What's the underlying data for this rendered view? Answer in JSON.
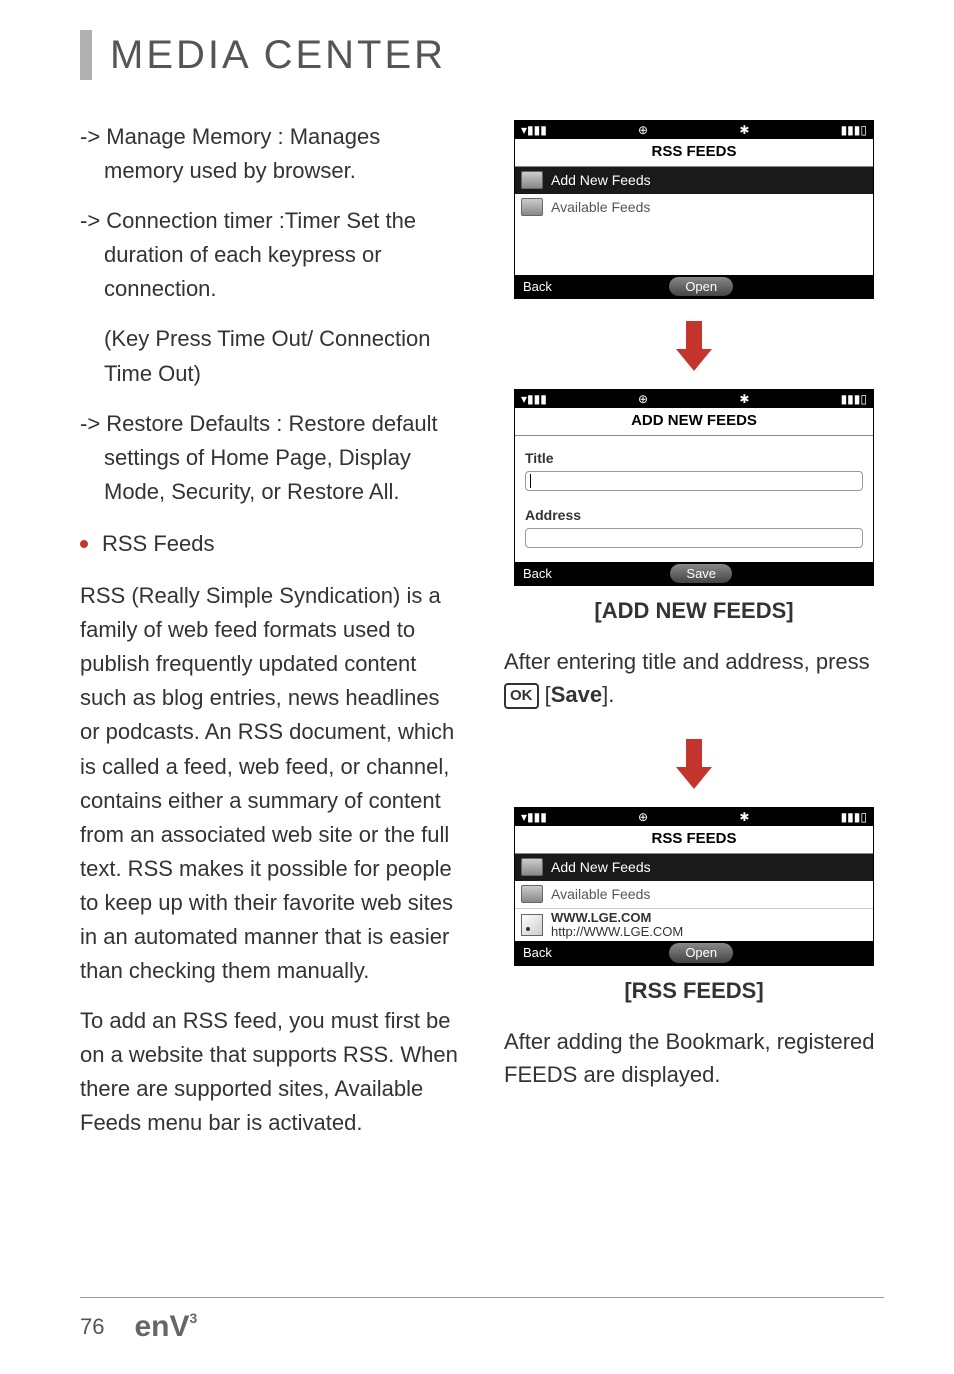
{
  "header": {
    "title": "MEDIA CENTER"
  },
  "left": {
    "item1": "-> Manage Memory : Manages memory used by browser.",
    "item2": "-> Connection timer :Timer Set the duration of each keypress or connection.",
    "item2_sub": "(Key Press Time Out/ Connection Time Out)",
    "item3": "-> Restore Defaults : Restore default settings of Home Page, Display Mode, Security, or Restore All.",
    "bullet": "RSS Feeds",
    "para1": "RSS (Really Simple Syndication) is a family of web feed formats used to publish frequently updated content such as blog entries, news headlines or podcasts. An RSS document, which is called a feed, web feed, or channel, contains either a summary of content from an associated web site or the full text. RSS makes it possible for people to keep up with their favorite web sites in an automated manner that is easier than checking them manually.",
    "para2": "To add an RSS feed, you must first be on a website that supports RSS. When there are supported sites, Available Feeds menu bar is activated."
  },
  "screen1": {
    "title": "RSS FEEDS",
    "row1": "Add New Feeds",
    "row2": "Available Feeds",
    "soft_left": "Back",
    "soft_center": "Open"
  },
  "screen2": {
    "title": "ADD NEW FEEDS",
    "label1": "Title",
    "label2": "Address",
    "soft_left": "Back",
    "soft_center": "Save"
  },
  "caption2": "[ADD NEW FEEDS]",
  "instr2_a": "After entering title and address, press ",
  "instr2_ok": "OK",
  "instr2_b": " [",
  "instr2_save": "Save",
  "instr2_c": "].",
  "screen3": {
    "title": "RSS FEEDS",
    "row1": "Add New Feeds",
    "row2": "Available Feeds",
    "feed_name": "WWW.LGE.COM",
    "feed_url": "http://WWW.LGE.COM",
    "soft_left": "Back",
    "soft_center": "Open"
  },
  "caption3": "[RSS FEEDS]",
  "instr3": "After adding the Bookmark, registered FEEDS are displayed.",
  "footer": {
    "page": "76",
    "brand": "enV",
    "brand_sup": "3"
  }
}
